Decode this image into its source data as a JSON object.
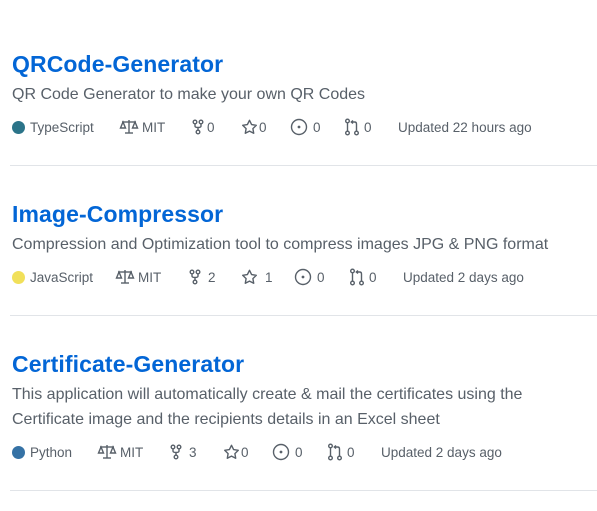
{
  "repos": [
    {
      "name": "QRCode-Generator",
      "description": "QR Code Generator to make your own QR Codes",
      "language": "TypeScript",
      "language_color": "#2b7489",
      "license": "MIT",
      "forks": "0",
      "stars": "0",
      "issues": "0",
      "pulls": "0",
      "updated": "Updated 22 hours ago"
    },
    {
      "name": "Image-Compressor",
      "description": "Compression and Optimization tool to compress images JPG & PNG format",
      "language": "JavaScript",
      "language_color": "#f1e05a",
      "license": "MIT",
      "forks": "2",
      "stars": "1",
      "issues": "0",
      "pulls": "0",
      "updated": "Updated 2 days ago"
    },
    {
      "name": "Certificate-Generator",
      "description": "This application will automatically create & mail the certificates using the Certificate image and the recipients details in an Excel sheet",
      "language": "Python",
      "language_color": "#3572A5",
      "license": "MIT",
      "forks": "3",
      "stars": "0",
      "issues": "0",
      "pulls": "0",
      "updated": "Updated 2 days ago"
    }
  ],
  "icons": {
    "license": "law-icon",
    "forks": "fork-icon",
    "stars": "star-icon",
    "issues": "issue-icon",
    "pulls": "pull-request-icon"
  }
}
